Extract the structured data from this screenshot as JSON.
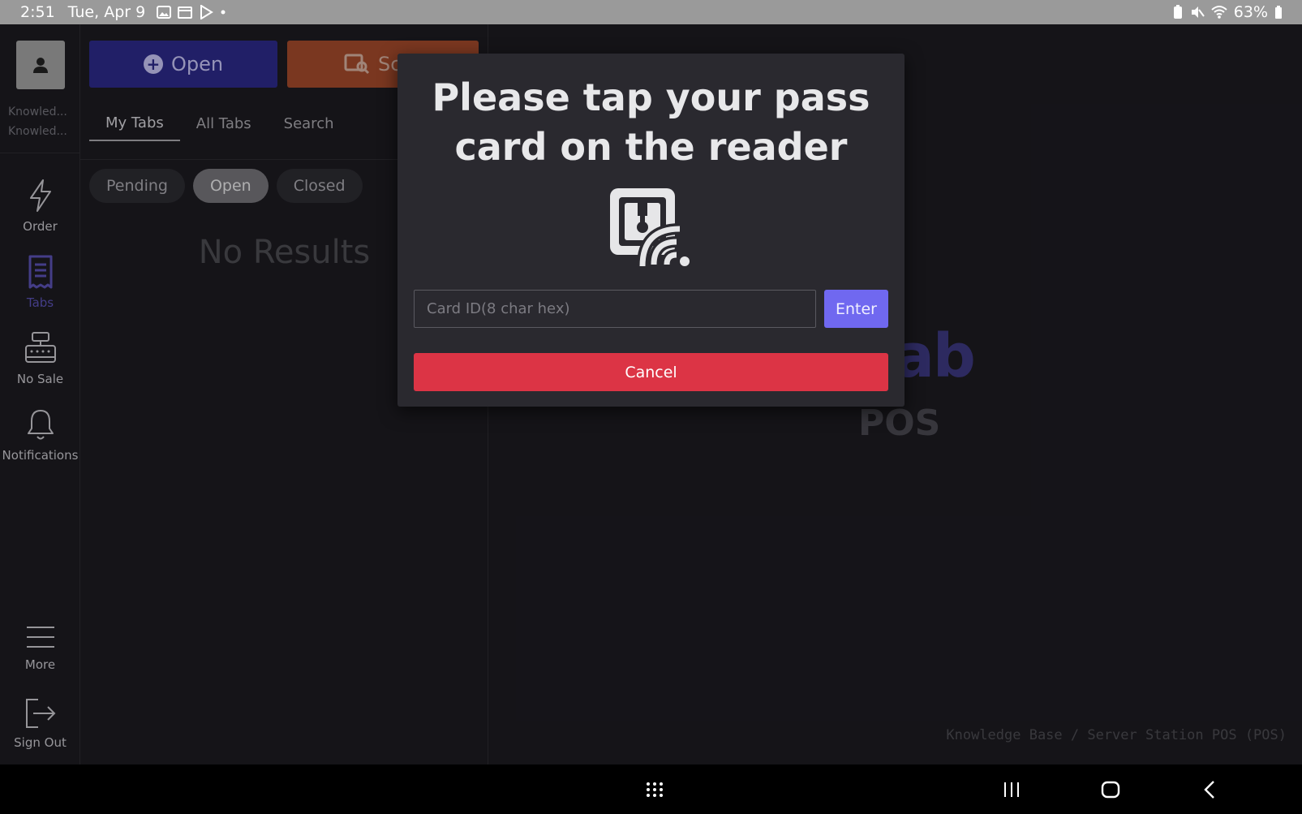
{
  "status_bar": {
    "time": "2:51",
    "date": "Tue, Apr 9",
    "battery": "63%"
  },
  "user": {
    "line1": "Knowled...",
    "line2": "Knowled..."
  },
  "rail": {
    "items": [
      {
        "label": "Order",
        "icon": "lightning-icon"
      },
      {
        "label": "Tabs",
        "icon": "receipt-icon",
        "active": true
      },
      {
        "label": "No Sale",
        "icon": "cash-register-icon"
      },
      {
        "label": "Notifications",
        "icon": "bell-icon"
      }
    ],
    "bottom": [
      {
        "label": "More",
        "icon": "menu-icon"
      },
      {
        "label": "Sign Out",
        "icon": "sign-out-icon"
      }
    ]
  },
  "panel": {
    "open_button": "Open",
    "scan_button": "Sc",
    "tabs": [
      "My Tabs",
      "All Tabs",
      "Search"
    ],
    "active_tab": "My Tabs",
    "filters": [
      "Pending",
      "Open",
      "Closed"
    ],
    "active_filter": "Open",
    "empty_text": "No Results"
  },
  "main": {
    "logo_partial": "ab",
    "logo_sub": "POS",
    "footer_path": "Knowledge Base / Server Station POS (POS)"
  },
  "dialog": {
    "title": "Please tap your pass card on the reader",
    "icon": "nfc-reader-icon",
    "input_placeholder": "Card ID(8 char hex)",
    "input_value": "",
    "enter_label": "Enter",
    "cancel_label": "Cancel"
  },
  "colors": {
    "open_button": "#2d2a8a",
    "scan_button": "#a34a2b",
    "enter_button": "#7068f0",
    "cancel_button": "#dc3445",
    "active_nav": "#5b52b5"
  }
}
